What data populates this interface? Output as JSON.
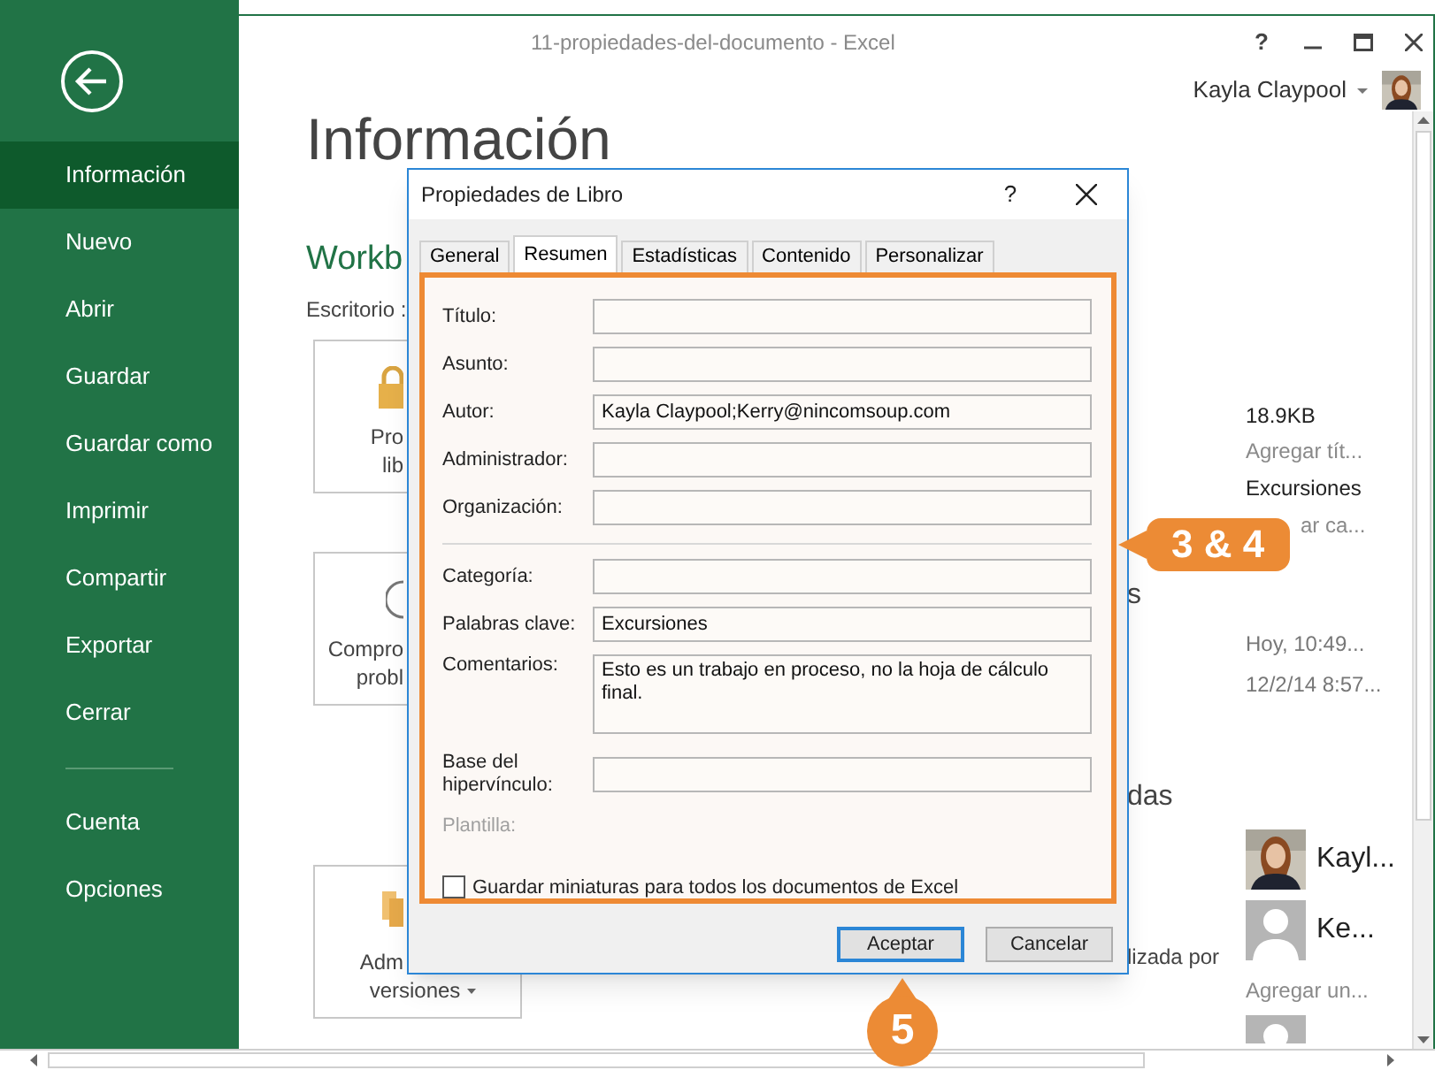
{
  "window": {
    "title": "11-propiedades-del-documento - Excel",
    "help": "?"
  },
  "user": {
    "name": "Kayla Claypool"
  },
  "sidebar": {
    "items": [
      {
        "label": "Información",
        "selected": true
      },
      {
        "label": "Nuevo",
        "selected": false
      },
      {
        "label": "Abrir",
        "selected": false
      },
      {
        "label": "Guardar",
        "selected": false
      },
      {
        "label": "Guardar como",
        "selected": false
      },
      {
        "label": "Imprimir",
        "selected": false
      },
      {
        "label": "Compartir",
        "selected": false
      },
      {
        "label": "Exportar",
        "selected": false
      },
      {
        "label": "Cerrar",
        "selected": false
      }
    ],
    "bottom_items": [
      {
        "label": "Cuenta",
        "selected": false
      },
      {
        "label": "Opciones",
        "selected": false
      }
    ]
  },
  "page": {
    "heading": "Información",
    "file_name": "Workb",
    "location": "Escritorio :",
    "tiles": [
      {
        "kind": "protect",
        "lines": [
          {
            "text": "Pro",
            "covered": true
          },
          {
            "text": "lib",
            "covered": true
          }
        ]
      },
      {
        "kind": "inspect",
        "lines": [
          {
            "text": "Compro",
            "covered": true
          },
          {
            "text": "probl",
            "covered": true
          }
        ]
      },
      {
        "kind": "versions",
        "lines": [
          {
            "text": "Adm",
            "covered": true
          },
          {
            "text": "versiones",
            "covered": false
          }
        ],
        "has_menu": true
      }
    ],
    "fragments": [
      {
        "text": "s",
        "kind": "heading"
      },
      {
        "text": "das",
        "kind": "heading"
      },
      {
        "text": "lizada por",
        "kind": "label"
      }
    ],
    "properties": [
      {
        "text": "18.9KB",
        "kind": "value"
      },
      {
        "text": "Agregar tít...",
        "kind": "placeholder"
      },
      {
        "text": "Excursiones",
        "kind": "value"
      },
      {
        "text": "ar ca...",
        "kind": "placeholder"
      }
    ],
    "dates": [
      "Hoy, 10:49...",
      "12/2/14 8:57..."
    ],
    "people": [
      {
        "name": "Kayl..."
      },
      {
        "name": "Ke...",
        "kind": "generic"
      }
    ],
    "add_person": "Agregar un...",
    "more_people": [
      {
        "kind": "generic"
      }
    ]
  },
  "dialog": {
    "title": "Propiedades de Libro",
    "help": "?",
    "tabs": [
      {
        "label": "General",
        "selected": false
      },
      {
        "label": "Resumen",
        "selected": true
      },
      {
        "label": "Estadísticas",
        "selected": false
      },
      {
        "label": "Contenido",
        "selected": false
      },
      {
        "label": "Personalizar",
        "selected": false
      }
    ],
    "groups": [
      [
        {
          "label": "Título:",
          "kind": "text"
        },
        {
          "label": "Asunto:",
          "kind": "text"
        },
        {
          "label": "Autor:",
          "kind": "text",
          "value": "Kayla Claypool;Kerry@nincomsoup.com"
        },
        {
          "label": "Administrador:",
          "kind": "text"
        },
        {
          "label": "Organización:",
          "kind": "text"
        }
      ],
      [
        {
          "label": "Categoría:",
          "kind": "text"
        },
        {
          "label": "Palabras clave:",
          "kind": "text",
          "value": "Excursiones"
        },
        {
          "label": "Comentarios:",
          "kind": "multiline",
          "value": "Esto es un trabajo en proceso, no la hoja de cálculo final."
        },
        {
          "label": "Base del hipervínculo:",
          "kind": "text"
        }
      ]
    ],
    "template_label": "Plantilla:",
    "thumbnail_checkbox": {
      "label": "Guardar miniaturas para todos los documentos de Excel",
      "checked": false
    },
    "buttons": [
      {
        "label": "Aceptar",
        "default": true
      },
      {
        "label": "Cancelar",
        "default": false
      }
    ]
  },
  "callouts": [
    {
      "text": "3 & 4",
      "kind": "left"
    },
    {
      "text": "5",
      "kind": "up"
    }
  ]
}
